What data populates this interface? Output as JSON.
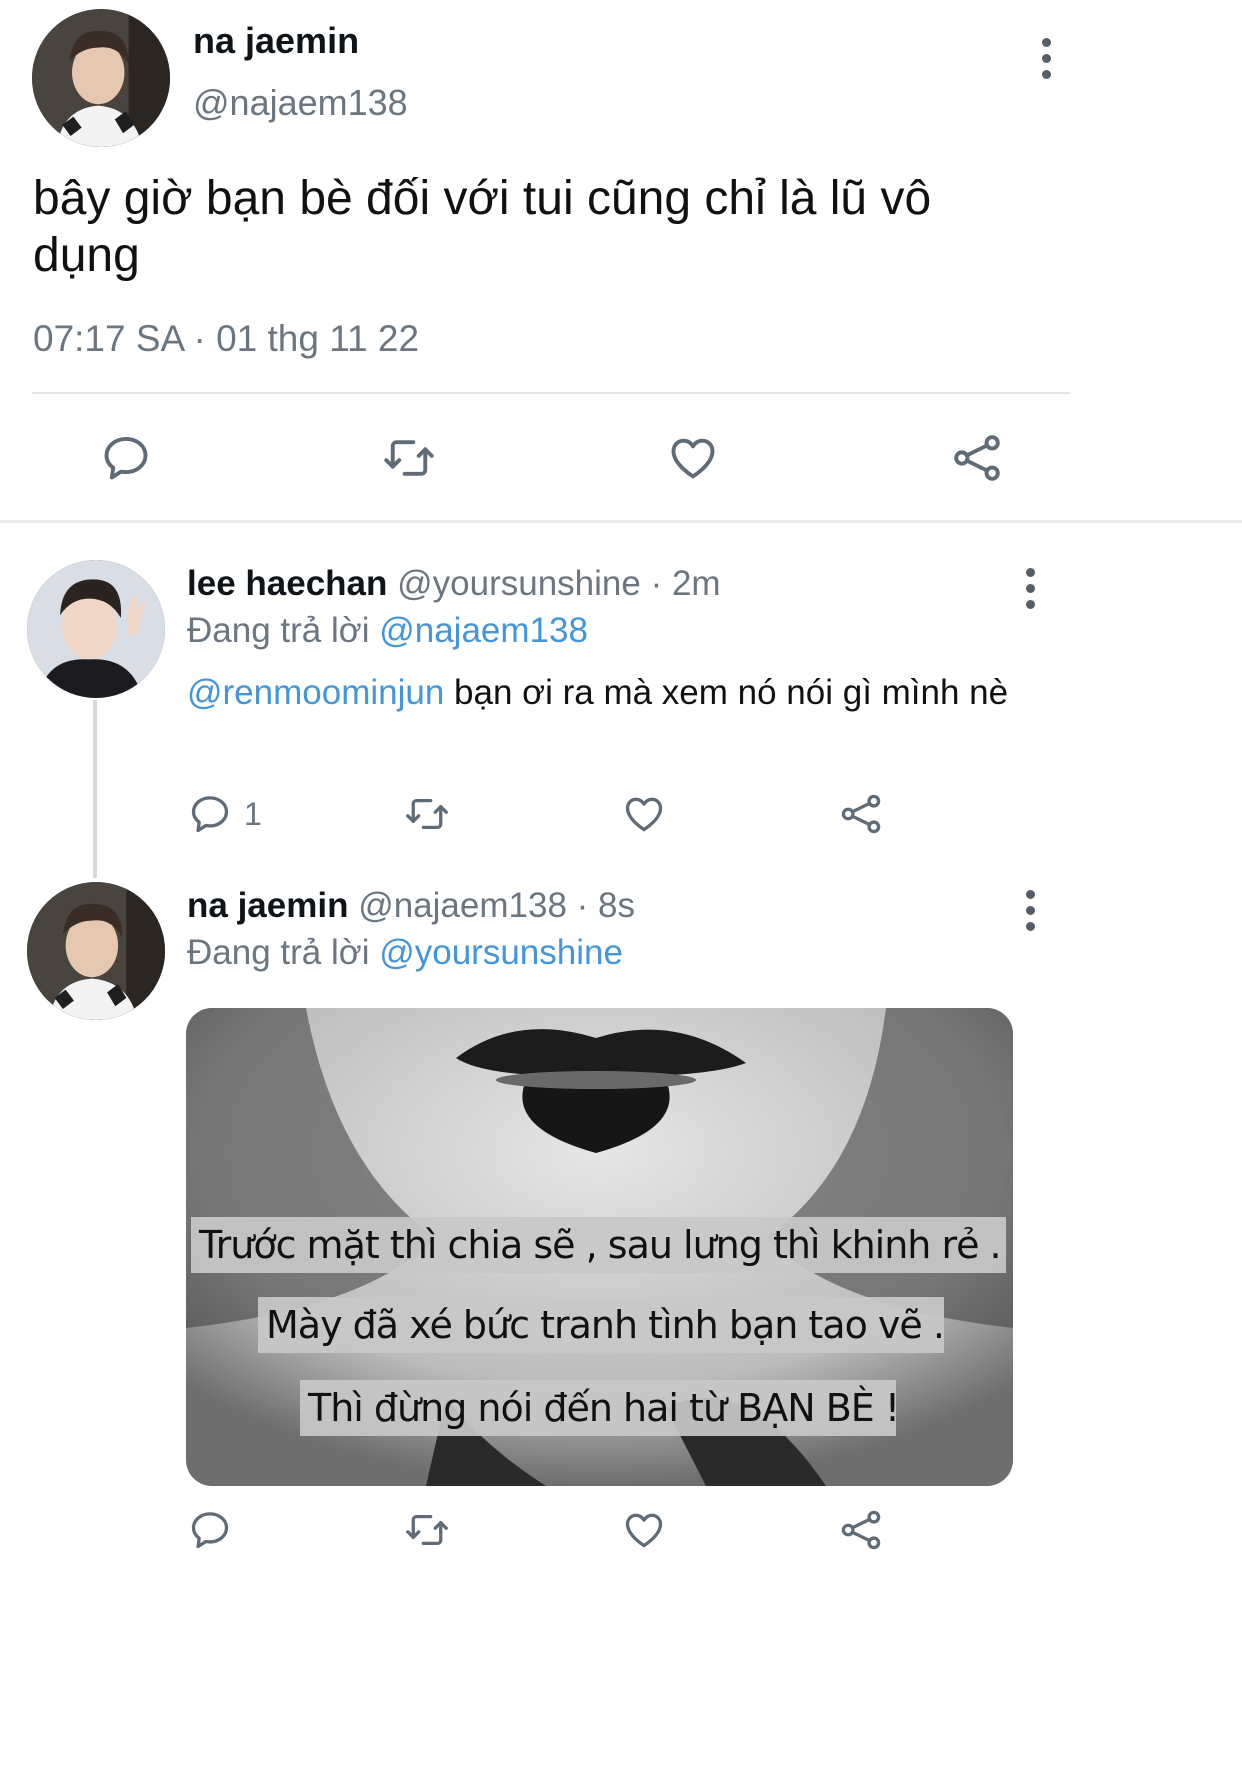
{
  "main_tweet": {
    "display_name": "na jaemin",
    "handle": "@najaem138",
    "text": "bây giờ bạn bè đối với tui cũng chỉ là lũ vô dụng",
    "timestamp": "07:17 SA · 01 thg 11 22"
  },
  "replies": [
    {
      "display_name": "lee haechan",
      "handle_time": "@yoursunshine · 2m",
      "replying_prefix": "Đang trả lời",
      "replying_to": "@najaem138",
      "mention": "@renmoominjun",
      "text": "bạn ơi ra mà xem nó nói gì mình nè",
      "reply_count": "1"
    },
    {
      "display_name": "na jaemin",
      "handle_time": "@najaem138 · 8s",
      "replying_prefix": "Đang trả lời",
      "replying_to": "@yoursunshine",
      "image_caption": [
        "Trước mặt thì chia sẽ , sau lưng thì khinh rẻ .",
        "Mày đã xé bức tranh tình bạn tao vẽ ..",
        "Thì đừng nói đến hai từ BẠN BÈ !"
      ]
    }
  ]
}
